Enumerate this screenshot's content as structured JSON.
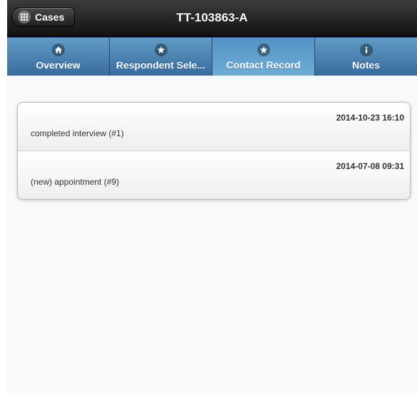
{
  "header": {
    "back_button_label": "Cases",
    "title": "TT-103863-A"
  },
  "nav": {
    "tabs": [
      {
        "label": "Overview",
        "icon": "home-icon",
        "active": false
      },
      {
        "label": "Respondent Sele...",
        "icon": "star-icon",
        "active": false
      },
      {
        "label": "Contact Record",
        "icon": "star-icon",
        "active": true
      },
      {
        "label": "Notes",
        "icon": "info-icon",
        "active": false
      }
    ]
  },
  "contacts": [
    {
      "date": "2014-10-23 16:10",
      "description": "completed interview (#1)"
    },
    {
      "date": "2014-07-08 09:31",
      "description": "(new) appointment (#9)"
    }
  ],
  "colors": {
    "header_bg": "#1e1e1e",
    "nav_bg": "#396b9e",
    "nav_active_bg": "#5f9cc5"
  }
}
